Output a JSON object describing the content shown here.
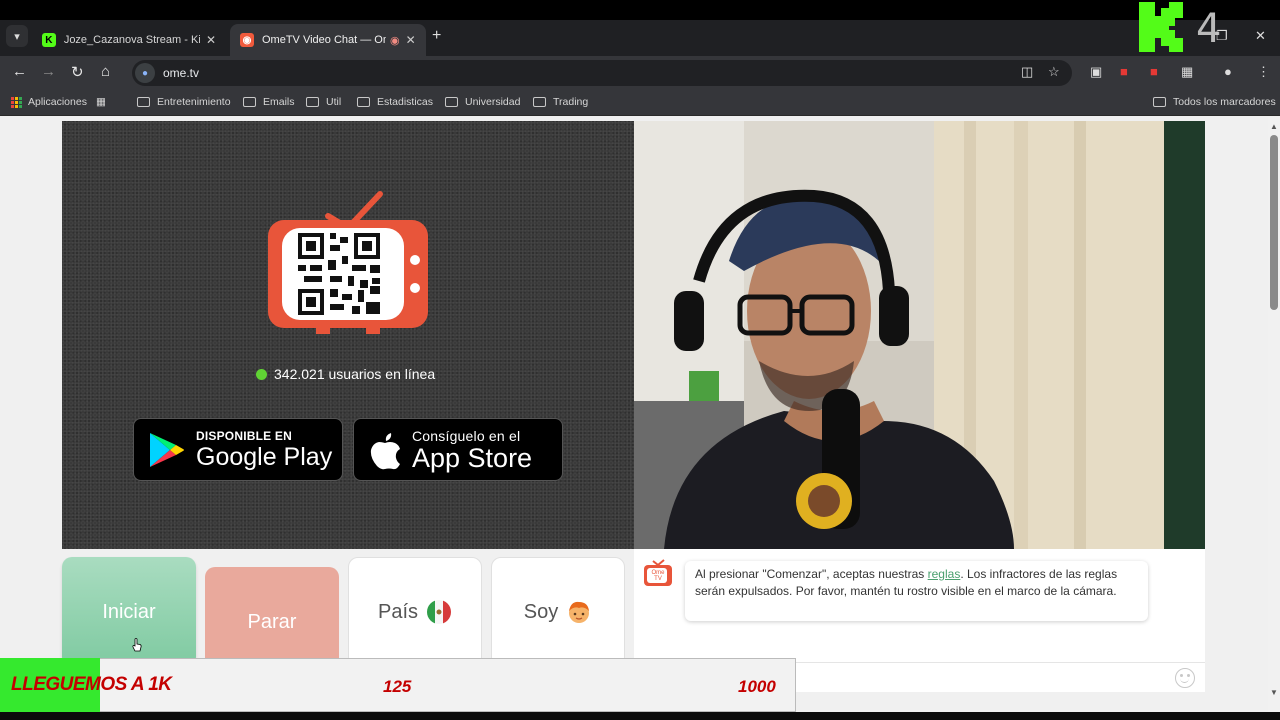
{
  "browser": {
    "tabs": [
      {
        "title": "Joze_Cazanova Stream - Kick Dev",
        "active": false
      },
      {
        "title": "OmeTV Video Chat — Omegle",
        "active": true
      }
    ],
    "overlay_number": "4",
    "url": "ome.tv",
    "bookmarks": [
      {
        "label": "Aplicaciones",
        "icon": "apps-icon"
      },
      {
        "label": "Entretenimiento",
        "icon": "folder-icon"
      },
      {
        "label": "Emails",
        "icon": "folder-icon"
      },
      {
        "label": "Util",
        "icon": "folder-icon"
      },
      {
        "label": "Estadisticas",
        "icon": "folder-icon"
      },
      {
        "label": "Universidad",
        "icon": "folder-icon"
      },
      {
        "label": "Trading",
        "icon": "folder-icon"
      }
    ],
    "all_bookmarks": "Todos los marcadores",
    "accent": "#35363a"
  },
  "page": {
    "online_count": "342.021 usuarios en línea",
    "google_play": {
      "small": "DISPONIBLE EN",
      "big": "Google Play"
    },
    "app_store": {
      "small": "Consíguelo en el",
      "big": "App Store"
    },
    "buttons": {
      "start": "Iniciar",
      "stop": "Parar",
      "country": "País",
      "gender": "Soy"
    },
    "chat": {
      "logo_text": "Ome TV",
      "message_before": "Al presionar \"Comenzar\", aceptas nuestras ",
      "message_link": "reglas",
      "message_after": ". Los infractores de las reglas serán expulsados. Por favor, mantén tu rostro visible en el marco de la cámara."
    }
  },
  "stream_overlay": {
    "goal_label": "LLEGUEMOS A 1K",
    "current": "125",
    "target": "1000",
    "progress": 0.125,
    "fill_color": "#35e92e"
  }
}
